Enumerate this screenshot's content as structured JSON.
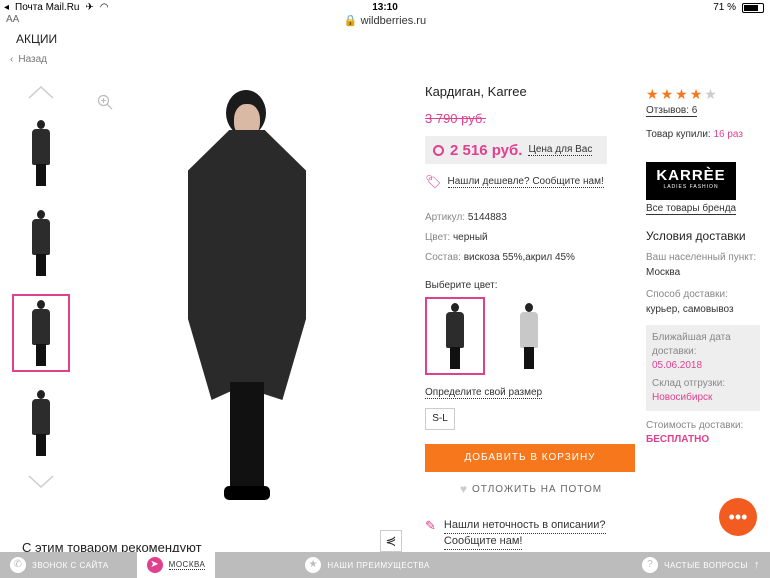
{
  "statusbar": {
    "carrier": "Почта Mail.Ru",
    "time": "13:10",
    "battery": "71 %"
  },
  "browser": {
    "aa": "AA",
    "url": "wildberries.ru"
  },
  "nav": {
    "akcii": "АКЦИИ",
    "back": "Назад"
  },
  "gallery": {
    "recommend": "С этим товаром рекомендуют"
  },
  "product": {
    "title": "Кардиган, Karree",
    "old_price": "3 790 руб.",
    "price": "2 516 руб.",
    "your_price_label": "Цена для Вас",
    "cheaper_link": "Нашли дешевле? Сообщите нам!",
    "specs": [
      {
        "key": "Артикул:",
        "value": "5144883"
      },
      {
        "key": "Цвет:",
        "value": "черный"
      },
      {
        "key": "Состав:",
        "value": "вискоза 55%,акрил 45%"
      }
    ],
    "choose_color": "Выберите цвет:",
    "size_link": "Определите свой размер",
    "size": "S-L",
    "add_to_cart": "ДОБАВИТЬ В КОРЗИНУ",
    "postpone": "ОТЛОЖИТЬ НА ПОТОМ",
    "error_link_1": "Нашли неточность в описании?",
    "error_link_2": "Сообщите нам!"
  },
  "sidebar": {
    "rating": 4,
    "reviews": "Отзывов: 6",
    "bought_label": "Товар купили:",
    "bought_count": "16 раз",
    "brand_logo": "KARRÈE",
    "brand_logo_sub": "LADIES FASHION",
    "all_brand": "Все товары бренда",
    "delivery_title": "Условия доставки",
    "city_label": "Ваш населенный пункт:",
    "city": "Москва",
    "method_label": "Способ доставки:",
    "method": "курьер, самовывоз",
    "date_label": "Ближайшая дата доставки:",
    "date": "05.06.2018",
    "warehouse_label": "Склад отгрузки:",
    "warehouse": "Новосибирск",
    "cost_label": "Стоимость доставки:",
    "cost": "БЕСПЛАТНО"
  },
  "bottombar": {
    "call": "ЗВОНОК С САЙТА",
    "city": "МОСКВА",
    "advantages": "НАШИ ПРЕИМУЩЕСТВА",
    "faq": "ЧАСТЫЕ ВОПРОСЫ"
  },
  "colors": {
    "accent": "#e0418f",
    "orange": "#f7781c"
  }
}
